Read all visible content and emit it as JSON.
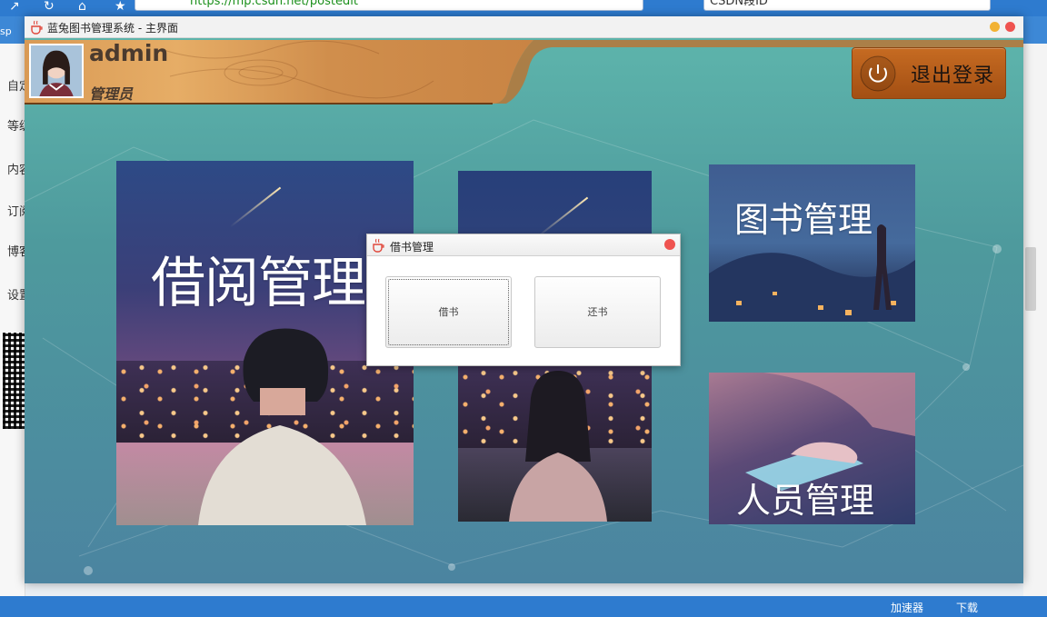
{
  "browser": {
    "address_text": "https://mp.csdn.net/postedit",
    "search_text": "CSDN段ID",
    "left_menu": [
      "自定",
      "等级权益",
      "内容收益",
      "订阅收益",
      "博客打赏",
      "设置管理"
    ],
    "left_partial_label": "sp",
    "status_items": {
      "accelerator": "加速器",
      "download": "下载"
    }
  },
  "app": {
    "window_title": "蓝兔图书管理系统 - 主界面",
    "user": {
      "name": "admin",
      "role": "管理员"
    },
    "logout_label": "退出登录",
    "tiles": {
      "borrow": "借阅管理",
      "books": "图书管理",
      "people": "人员管理"
    },
    "colors": {
      "accent_wood": "#d28a45",
      "logout_btn": "#b55c1a",
      "close_red": "#ef5350"
    }
  },
  "dialog": {
    "title": "借书管理",
    "borrow_label": "借书",
    "return_label": "还书"
  }
}
